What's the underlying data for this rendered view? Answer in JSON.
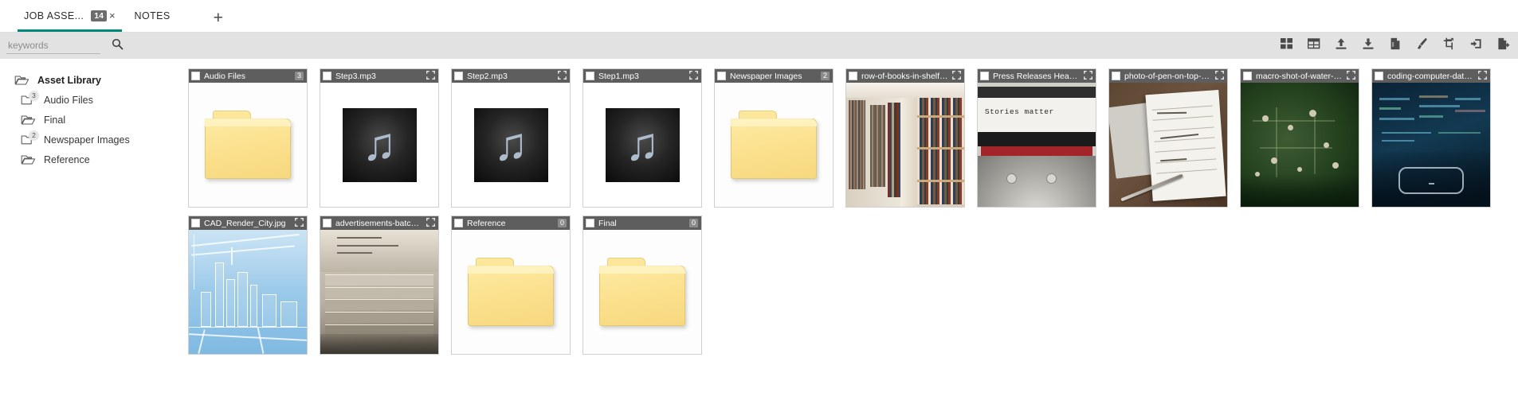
{
  "tabs": [
    {
      "label": "JOB ASSE...",
      "badge": "14",
      "close": "×",
      "active": true
    },
    {
      "label": "NOTES",
      "badge": "",
      "close": "",
      "active": false
    }
  ],
  "tab_add_label": "+",
  "search": {
    "placeholder": "keywords",
    "value": "",
    "icon": "search-icon"
  },
  "toolbar_icons": [
    {
      "name": "grid-view-icon"
    },
    {
      "name": "table-view-icon"
    },
    {
      "name": "upload-icon"
    },
    {
      "name": "download-icon"
    },
    {
      "name": "document-icon"
    },
    {
      "name": "brush-icon"
    },
    {
      "name": "crop-icon"
    },
    {
      "name": "import-icon"
    },
    {
      "name": "export-icon"
    }
  ],
  "sidebar": {
    "items": [
      {
        "label": "Asset Library",
        "badge": "",
        "root": true
      },
      {
        "label": "Audio Files",
        "badge": "3",
        "root": false
      },
      {
        "label": "Final",
        "badge": "",
        "root": false
      },
      {
        "label": "Newspaper Images",
        "badge": "2",
        "root": false
      },
      {
        "label": "Reference",
        "badge": "",
        "root": false
      }
    ]
  },
  "assets": [
    {
      "title": "Audio Files",
      "count": "3",
      "kind": "folder"
    },
    {
      "title": "Step3.mp3",
      "count": "",
      "kind": "audio"
    },
    {
      "title": "Step2.mp3",
      "count": "",
      "kind": "audio"
    },
    {
      "title": "Step1.mp3",
      "count": "",
      "kind": "audio"
    },
    {
      "title": "Newspaper Images",
      "count": "2",
      "kind": "folder"
    },
    {
      "title": "row-of-books-in-shelf-...",
      "count": "",
      "kind": "books"
    },
    {
      "title": "Press Releases Heade...",
      "count": "",
      "kind": "typewriter"
    },
    {
      "title": "photo-of-pen-on-top-o...",
      "count": "",
      "kind": "pen"
    },
    {
      "title": "macro-shot-of-water-d...",
      "count": "",
      "kind": "circuit"
    },
    {
      "title": "coding-computer-data...",
      "count": "",
      "kind": "code"
    },
    {
      "title": "CAD_Render_City.jpg",
      "count": "",
      "kind": "cad"
    },
    {
      "title": "advertisements-batch-...",
      "count": "",
      "kind": "news"
    },
    {
      "title": "Reference",
      "count": "0",
      "kind": "folder"
    },
    {
      "title": "Final",
      "count": "0",
      "kind": "folder"
    }
  ],
  "thumb_text": {
    "typewriter_line": "Stories matter"
  },
  "colors": {
    "accent": "#00897b",
    "card_header": "#5e5e5e",
    "toolstrip": "#e2e2e2",
    "folder_yellow": "#fbdf8b"
  }
}
